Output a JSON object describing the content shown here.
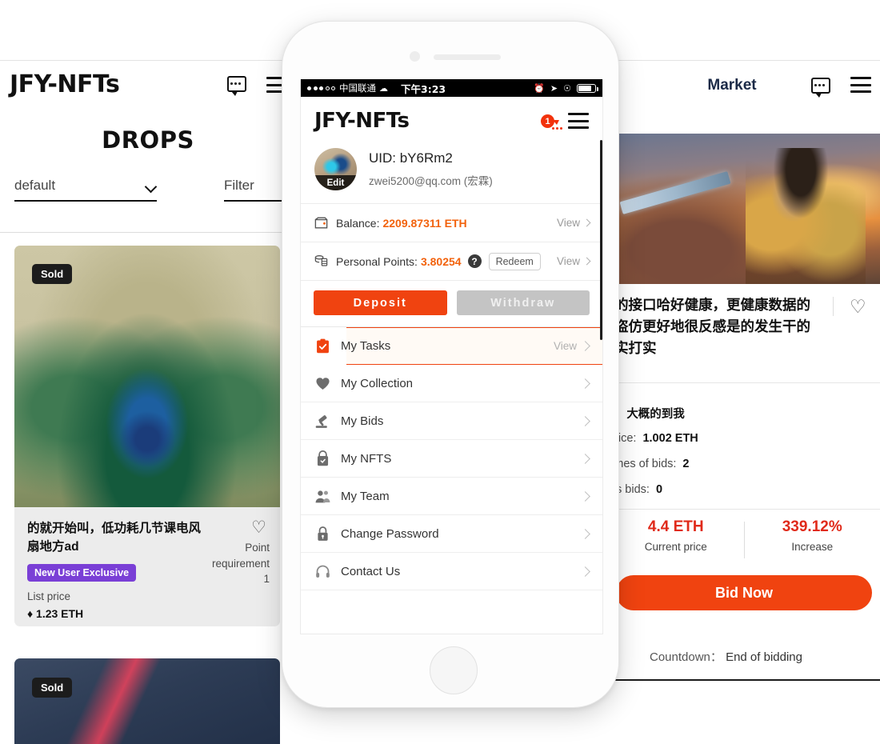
{
  "desktop": {
    "logo": "JFY-NFTs",
    "page_title": "DROPS",
    "market_title": "Market",
    "sort_select": "default",
    "filter_select": "Filter",
    "card": {
      "badge": "Sold",
      "title": "的就开始叫，低功耗几节课电风扇地方ad",
      "tag": "New User Exclusive",
      "list_price_label": "List price",
      "price": "♦ 1.23 ETH",
      "point_requirement_label": "Point requirement",
      "point_requirement_value": "1"
    },
    "card2": {
      "badge": "Sold"
    }
  },
  "detail": {
    "title": "的接口哈好健康，更健康数据的盗仿更好地很反感是的发生干的实打实",
    "specs": [
      {
        "label": "ts:",
        "value": "大概的到我"
      },
      {
        "label": "price:",
        "value": "1.002 ETH"
      },
      {
        "label": "times of bids:",
        "value": "2"
      },
      {
        "label": "y's bids:",
        "value": "0"
      }
    ],
    "current_price_value": "4.4 ETH",
    "current_price_label": "Current price",
    "increase_value": "339.12%",
    "increase_label": "Increase",
    "bid_button": "Bid Now",
    "countdown_label": "Countdown：",
    "countdown_value": "End of bidding"
  },
  "phone": {
    "status": {
      "carrier": "中国联通",
      "wifi_icon": "wifi-icon",
      "time": "下午3:23"
    },
    "header": {
      "logo": "JFY-NFTs",
      "chat_badge": "1"
    },
    "profile": {
      "edit_label": "Edit",
      "uid": "UID: bY6Rm2",
      "email": "zwei5200@qq.com (宏霖)"
    },
    "balance": {
      "label": "Balance:",
      "value": "2209.87311 ETH",
      "view": "View"
    },
    "points": {
      "label": "Personal Points:",
      "value": "3.80254",
      "help": "?",
      "redeem": "Redeem",
      "view": "View"
    },
    "actions": {
      "deposit": "Deposit",
      "withdraw": "Withdraw"
    },
    "menu": [
      {
        "label": "My Tasks",
        "icon": "clipboard-check-icon",
        "view": "View",
        "active": true
      },
      {
        "label": "My Collection",
        "icon": "heart-icon",
        "active": false
      },
      {
        "label": "My Bids",
        "icon": "gavel-icon",
        "active": false
      },
      {
        "label": "My NFTS",
        "icon": "bag-lock-icon",
        "active": false
      },
      {
        "label": "My Team",
        "icon": "people-icon",
        "active": false
      },
      {
        "label": "Change Password",
        "icon": "lock-icon",
        "active": false
      },
      {
        "label": "Contact Us",
        "icon": "headset-icon",
        "active": false
      }
    ]
  },
  "colors": {
    "accent_orange": "#f04310",
    "amount_orange": "#f2620c",
    "price_red": "#e02a1a",
    "tag_purple": "#7a3fd6"
  }
}
